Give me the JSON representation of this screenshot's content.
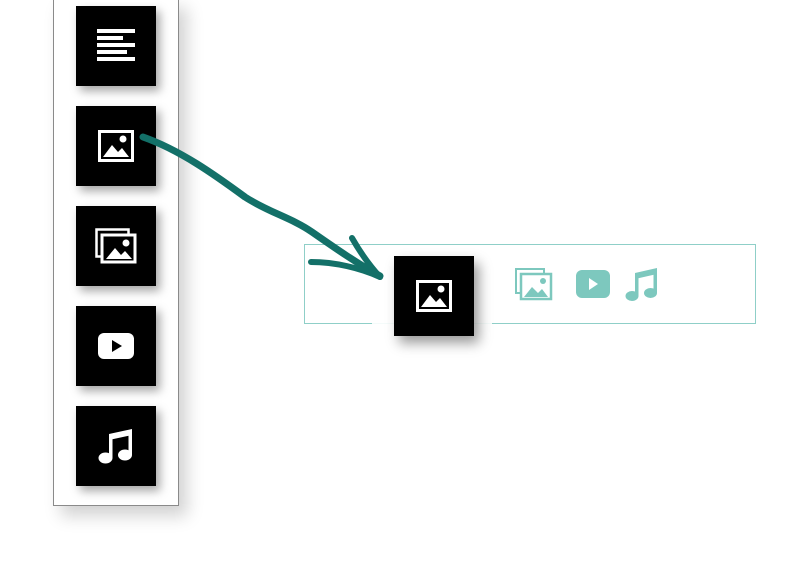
{
  "palette": {
    "tools": [
      {
        "name": "text-block",
        "icon": "text-lines-icon"
      },
      {
        "name": "image",
        "icon": "image-icon"
      },
      {
        "name": "gallery",
        "icon": "gallery-icon"
      },
      {
        "name": "video",
        "icon": "play-icon"
      },
      {
        "name": "audio",
        "icon": "music-note-icon"
      }
    ]
  },
  "dropzone": {
    "items": [
      {
        "name": "gallery",
        "icon": "gallery-icon"
      },
      {
        "name": "video",
        "icon": "play-icon"
      },
      {
        "name": "audio",
        "icon": "music-note-icon"
      }
    ]
  },
  "drag": {
    "item": "image",
    "icon": "image-icon"
  },
  "colors": {
    "tile": "#000000",
    "icon": "#ffffff",
    "teal_accent": "#7dc8be",
    "arrow": "#137068",
    "border": "#8fcfc8"
  }
}
